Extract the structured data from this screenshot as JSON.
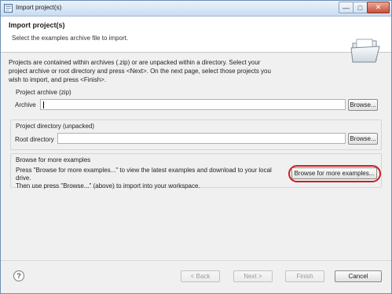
{
  "window": {
    "title": "Import project(s)",
    "min_glyph": "—",
    "max_glyph": "□",
    "close_glyph": "✕"
  },
  "header": {
    "title": "Import project(s)",
    "subtitle": "Select the examples archive file to import."
  },
  "intro": {
    "line1": "Projects are contained within archives (.zip) or are unpacked within a directory. Select your",
    "line2": "project archive or root directory and press <Next>. On the next page, select those projects you",
    "line3": "wish to import, and press <Finish>."
  },
  "archive_group": {
    "label": "Project archive (zip)",
    "field_label": "Archive",
    "field_value": "",
    "browse_label": "Browse..."
  },
  "directory_group": {
    "label": "Project directory (unpacked)",
    "field_label": "Root directory",
    "field_value": "",
    "browse_label": "Browse..."
  },
  "more_group": {
    "label": "Browse for more examples",
    "desc_line1": "Press \"Browse for more examples...\" to view the latest examples and download to your local drive.",
    "desc_line2": "Then use press \"Browse...\" (above) to import into your workspace.",
    "button_label": "Browse for more examples..."
  },
  "footer": {
    "help_glyph": "?",
    "back_label": "< Back",
    "next_label": "Next >",
    "finish_label": "Finish",
    "cancel_label": "Cancel"
  },
  "colors": {
    "highlight_ring": "#c81e1e",
    "titlebar": "#c9dcf0",
    "close_button": "#c8513a"
  },
  "icons": {
    "app": "eclipse-window-icon",
    "wizard": "open-folder-icon",
    "help": "help-icon"
  }
}
